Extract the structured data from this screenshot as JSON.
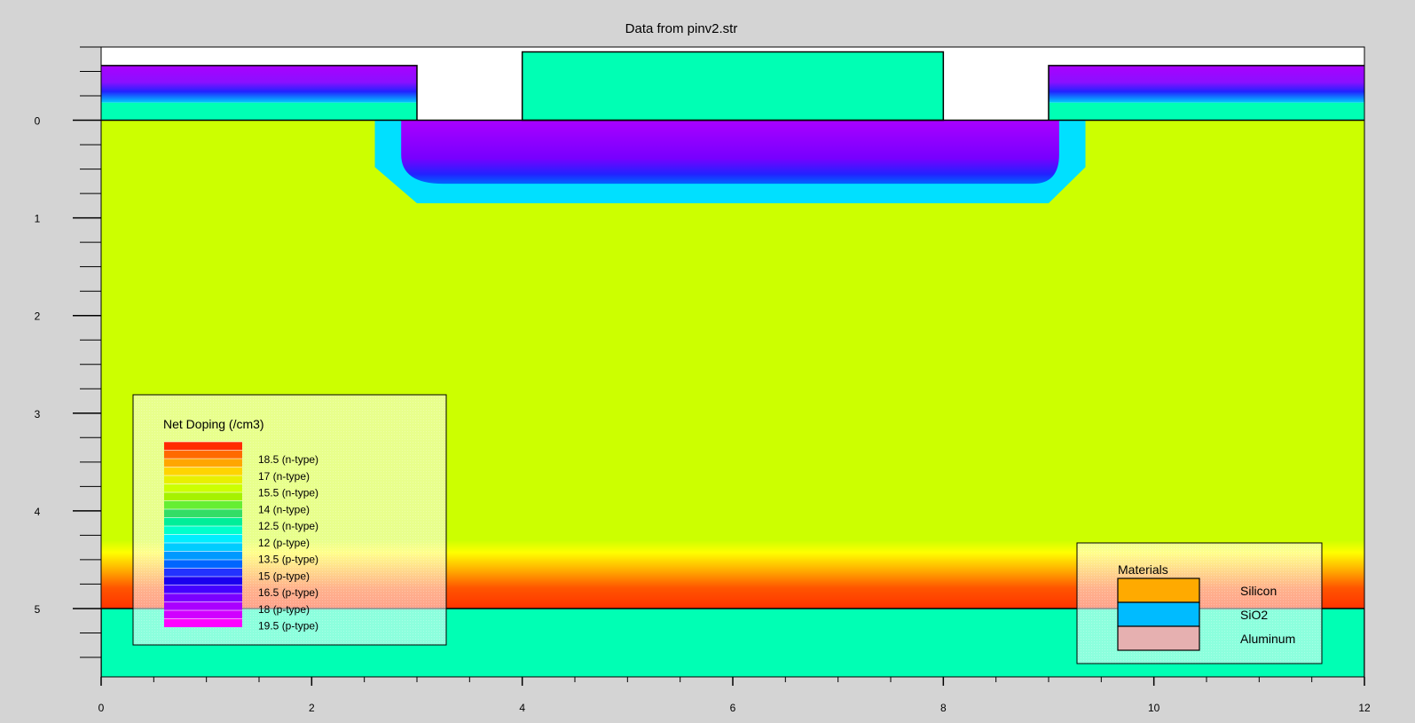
{
  "chart_data": {
    "type": "heatmap",
    "title": "Data from pinv2.str",
    "xlabel": "",
    "ylabel": "",
    "xlim": [
      0,
      12
    ],
    "ylim": [
      5.7,
      -0.75
    ],
    "x_ticks": [
      "0",
      "2",
      "4",
      "6",
      "8",
      "10",
      "12"
    ],
    "y_ticks": [
      "0",
      "1",
      "2",
      "3",
      "4",
      "5"
    ],
    "regions": [
      {
        "material": "Silicon",
        "net_doping_log10": 15,
        "doping_type": "n-type",
        "x": [
          0,
          12
        ],
        "y": [
          0,
          4.3
        ]
      },
      {
        "material": "Silicon",
        "net_doping_log10": 18.5,
        "doping_type": "n-type",
        "x": [
          0,
          12
        ],
        "y": [
          4.3,
          5.0
        ]
      },
      {
        "material": "Silicon",
        "net_doping_log10": 18,
        "doping_type": "p-type",
        "x": [
          2.85,
          9.1
        ],
        "y": [
          0,
          0.8
        ]
      },
      {
        "material": "SiO2",
        "x": [
          0,
          12
        ],
        "y": [
          5.0,
          5.7
        ]
      },
      {
        "material": "SiO2",
        "x": [
          4,
          8
        ],
        "y": [
          -0.7,
          0
        ]
      },
      {
        "material": "Aluminum",
        "net_doping_log10": 18,
        "doping_type": "p-type",
        "x": [
          0,
          3
        ],
        "y": [
          -0.56,
          0
        ]
      },
      {
        "material": "Aluminum",
        "net_doping_log10": 18,
        "doping_type": "p-type",
        "x": [
          9,
          12
        ],
        "y": [
          -0.56,
          0
        ]
      }
    ],
    "doping_legend": {
      "title": "Net Doping (/cm3)",
      "labels": [
        "18.5 (n-type)",
        "17 (n-type)",
        "15.5 (n-type)",
        "14 (n-type)",
        "12.5 (n-type)",
        "12 (p-type)",
        "13.5 (p-type)",
        "15 (p-type)",
        "16.5 (p-type)",
        "18 (p-type)",
        "19.5 (p-type)"
      ],
      "colors": [
        "#ff2a00",
        "#ff6a00",
        "#ffa600",
        "#ffd400",
        "#e8f000",
        "#ccff00",
        "#a6f200",
        "#66ee33",
        "#33dd66",
        "#00ee99",
        "#00ffcc",
        "#00eeff",
        "#00ccff",
        "#0099ff",
        "#0066ff",
        "#2233ff",
        "#1a00ee",
        "#4400ff",
        "#7a00ff",
        "#aa00ff",
        "#d000ff",
        "#ff00ff"
      ]
    },
    "materials_legend": {
      "title": "Materials",
      "items": [
        {
          "label": "Silicon",
          "color": "#ffaa00"
        },
        {
          "label": "SiO2",
          "color": "#00bbff"
        },
        {
          "label": "Aluminum",
          "color": "#e6b0b0"
        }
      ]
    }
  }
}
